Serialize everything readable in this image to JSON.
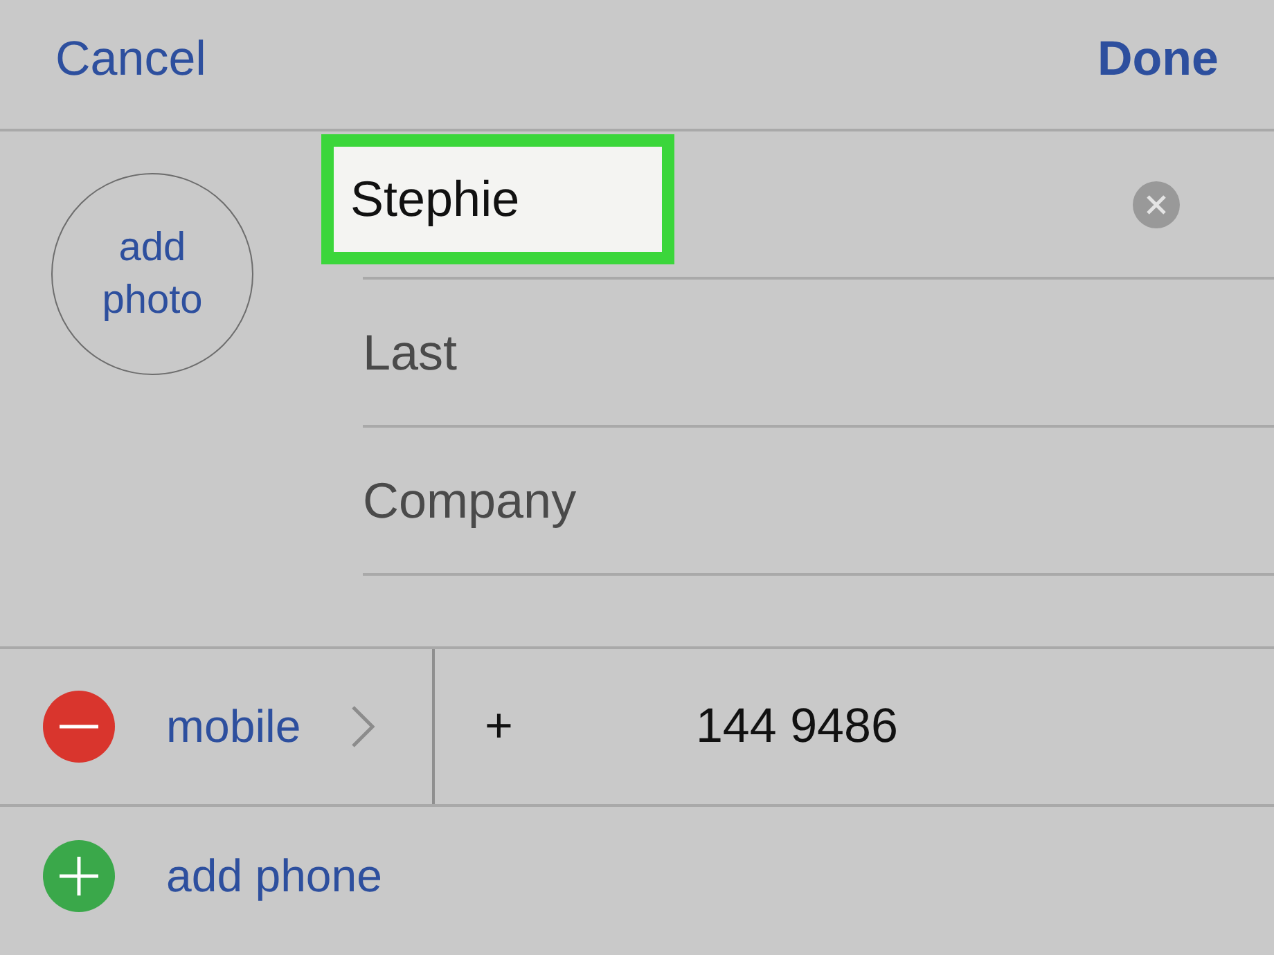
{
  "nav": {
    "cancel": "Cancel",
    "done": "Done"
  },
  "photo": {
    "label": "add photo"
  },
  "fields": [
    {
      "value": "Stephie",
      "highlighted": true,
      "clear_button": true
    },
    {
      "placeholder": "Last",
      "highlighted": false,
      "clear_button": false
    },
    {
      "placeholder": "Company",
      "highlighted": false,
      "clear_button": false
    }
  ],
  "phones": [
    {
      "label": "mobile",
      "prefix": "+",
      "number": "144 9486"
    }
  ],
  "add_phone": {
    "label": "add phone"
  }
}
